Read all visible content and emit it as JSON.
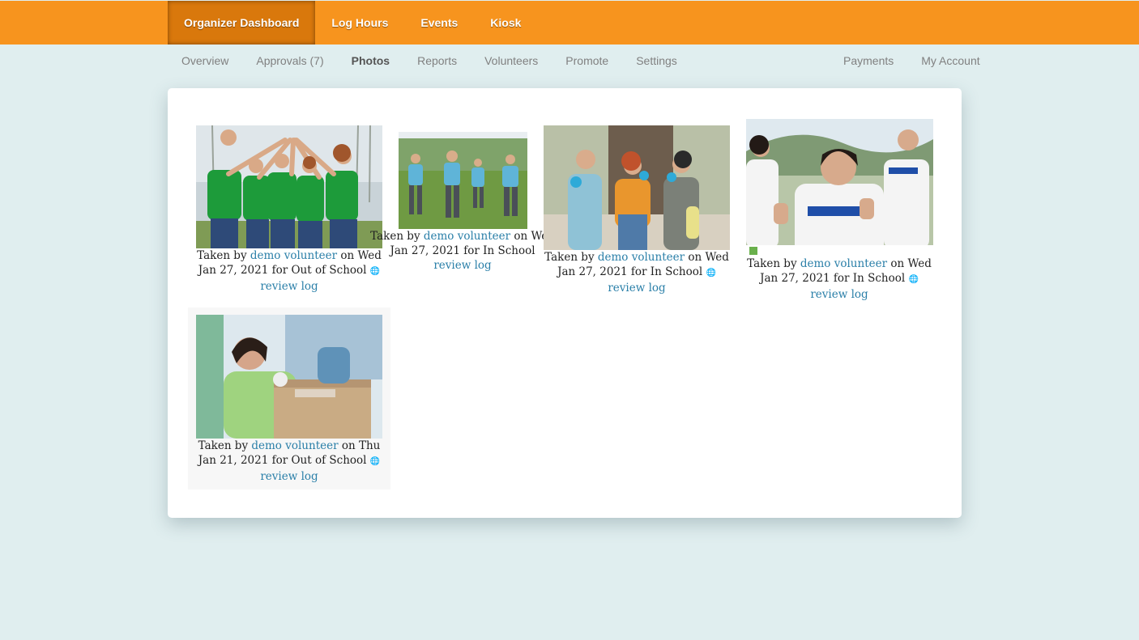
{
  "topnav": {
    "items": [
      {
        "label": "Organizer Dashboard",
        "active": true
      },
      {
        "label": "Log Hours"
      },
      {
        "label": "Events"
      },
      {
        "label": "Kiosk"
      }
    ]
  },
  "subnav": {
    "left": [
      {
        "label": "Overview"
      },
      {
        "label": "Approvals (7)"
      },
      {
        "label": "Photos",
        "active": true
      },
      {
        "label": "Reports"
      },
      {
        "label": "Volunteers"
      },
      {
        "label": "Promote"
      },
      {
        "label": "Settings"
      }
    ],
    "right": [
      {
        "label": "Payments"
      },
      {
        "label": "My Account"
      }
    ]
  },
  "colors": {
    "brand": "#f7941e",
    "link": "#2a7fa8",
    "background": "#e0eeef"
  },
  "photos": [
    {
      "taken_by": "Taken by ",
      "user": "demo volunteer",
      "on_text": " on Wed Jan 27, 2021 for Out of School ",
      "globe": "🌐",
      "review": "review log",
      "icon": "photo-volunteers-high-five"
    },
    {
      "taken_by": "Taken by ",
      "user": "demo volunteer",
      "on_text": " on Wed Jan 27, 2021 for In School",
      "globe": "",
      "review": "review log",
      "icon": "photo-volunteers-field"
    },
    {
      "taken_by": "Taken by ",
      "user": "demo volunteer",
      "on_text": " on Wed Jan 27, 2021 for In School ",
      "globe": "🌐",
      "review": "review log",
      "icon": "photo-volunteers-cleanup"
    },
    {
      "taken_by": "Taken by ",
      "user": "demo volunteer",
      "on_text": " on Wed Jan 27, 2021 for In School ",
      "globe": "🌐",
      "review": "review log",
      "icon": "photo-volunteer-thumbs-up"
    },
    {
      "taken_by": "Taken by ",
      "user": "demo volunteer",
      "on_text": " on Thu Jan 21, 2021 for Out of School ",
      "globe": "🌐",
      "review": "review log",
      "icon": "photo-volunteers-boxes"
    }
  ]
}
